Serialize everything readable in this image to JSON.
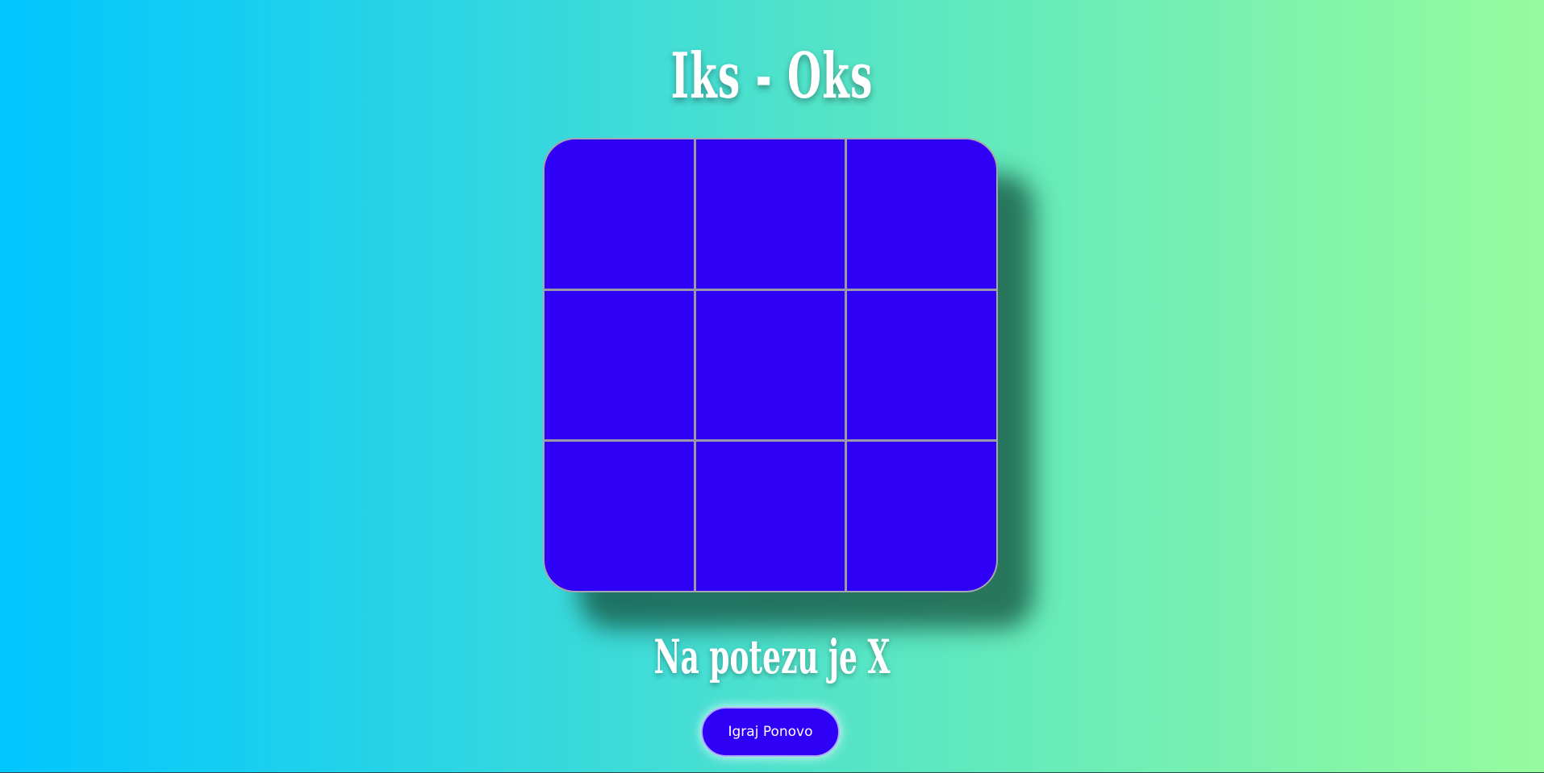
{
  "title": "Iks - Oks",
  "board": {
    "cells": [
      "",
      "",
      "",
      "",
      "",
      "",
      "",
      "",
      ""
    ]
  },
  "status": "Na potezu je X",
  "restart_label": "Igraj Ponovo",
  "colors": {
    "cell": "#2e00f5",
    "gradient_start": "#00c6ff",
    "gradient_end": "#96fb9e",
    "text": "#ffffff"
  }
}
